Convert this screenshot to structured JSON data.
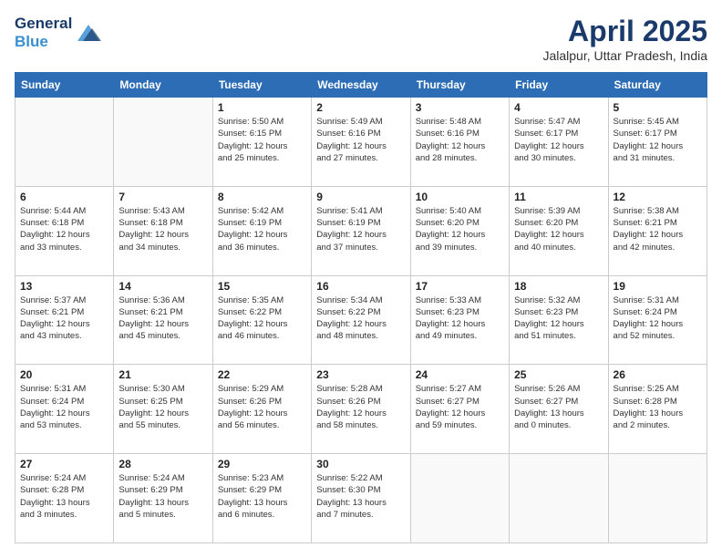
{
  "logo": {
    "line1": "General",
    "line2": "Blue"
  },
  "title": "April 2025",
  "location": "Jalalpur, Uttar Pradesh, India",
  "days_header": [
    "Sunday",
    "Monday",
    "Tuesday",
    "Wednesday",
    "Thursday",
    "Friday",
    "Saturday"
  ],
  "weeks": [
    [
      {
        "day": "",
        "info": ""
      },
      {
        "day": "",
        "info": ""
      },
      {
        "day": "1",
        "info": "Sunrise: 5:50 AM\nSunset: 6:15 PM\nDaylight: 12 hours\nand 25 minutes."
      },
      {
        "day": "2",
        "info": "Sunrise: 5:49 AM\nSunset: 6:16 PM\nDaylight: 12 hours\nand 27 minutes."
      },
      {
        "day": "3",
        "info": "Sunrise: 5:48 AM\nSunset: 6:16 PM\nDaylight: 12 hours\nand 28 minutes."
      },
      {
        "day": "4",
        "info": "Sunrise: 5:47 AM\nSunset: 6:17 PM\nDaylight: 12 hours\nand 30 minutes."
      },
      {
        "day": "5",
        "info": "Sunrise: 5:45 AM\nSunset: 6:17 PM\nDaylight: 12 hours\nand 31 minutes."
      }
    ],
    [
      {
        "day": "6",
        "info": "Sunrise: 5:44 AM\nSunset: 6:18 PM\nDaylight: 12 hours\nand 33 minutes."
      },
      {
        "day": "7",
        "info": "Sunrise: 5:43 AM\nSunset: 6:18 PM\nDaylight: 12 hours\nand 34 minutes."
      },
      {
        "day": "8",
        "info": "Sunrise: 5:42 AM\nSunset: 6:19 PM\nDaylight: 12 hours\nand 36 minutes."
      },
      {
        "day": "9",
        "info": "Sunrise: 5:41 AM\nSunset: 6:19 PM\nDaylight: 12 hours\nand 37 minutes."
      },
      {
        "day": "10",
        "info": "Sunrise: 5:40 AM\nSunset: 6:20 PM\nDaylight: 12 hours\nand 39 minutes."
      },
      {
        "day": "11",
        "info": "Sunrise: 5:39 AM\nSunset: 6:20 PM\nDaylight: 12 hours\nand 40 minutes."
      },
      {
        "day": "12",
        "info": "Sunrise: 5:38 AM\nSunset: 6:21 PM\nDaylight: 12 hours\nand 42 minutes."
      }
    ],
    [
      {
        "day": "13",
        "info": "Sunrise: 5:37 AM\nSunset: 6:21 PM\nDaylight: 12 hours\nand 43 minutes."
      },
      {
        "day": "14",
        "info": "Sunrise: 5:36 AM\nSunset: 6:21 PM\nDaylight: 12 hours\nand 45 minutes."
      },
      {
        "day": "15",
        "info": "Sunrise: 5:35 AM\nSunset: 6:22 PM\nDaylight: 12 hours\nand 46 minutes."
      },
      {
        "day": "16",
        "info": "Sunrise: 5:34 AM\nSunset: 6:22 PM\nDaylight: 12 hours\nand 48 minutes."
      },
      {
        "day": "17",
        "info": "Sunrise: 5:33 AM\nSunset: 6:23 PM\nDaylight: 12 hours\nand 49 minutes."
      },
      {
        "day": "18",
        "info": "Sunrise: 5:32 AM\nSunset: 6:23 PM\nDaylight: 12 hours\nand 51 minutes."
      },
      {
        "day": "19",
        "info": "Sunrise: 5:31 AM\nSunset: 6:24 PM\nDaylight: 12 hours\nand 52 minutes."
      }
    ],
    [
      {
        "day": "20",
        "info": "Sunrise: 5:31 AM\nSunset: 6:24 PM\nDaylight: 12 hours\nand 53 minutes."
      },
      {
        "day": "21",
        "info": "Sunrise: 5:30 AM\nSunset: 6:25 PM\nDaylight: 12 hours\nand 55 minutes."
      },
      {
        "day": "22",
        "info": "Sunrise: 5:29 AM\nSunset: 6:26 PM\nDaylight: 12 hours\nand 56 minutes."
      },
      {
        "day": "23",
        "info": "Sunrise: 5:28 AM\nSunset: 6:26 PM\nDaylight: 12 hours\nand 58 minutes."
      },
      {
        "day": "24",
        "info": "Sunrise: 5:27 AM\nSunset: 6:27 PM\nDaylight: 12 hours\nand 59 minutes."
      },
      {
        "day": "25",
        "info": "Sunrise: 5:26 AM\nSunset: 6:27 PM\nDaylight: 13 hours\nand 0 minutes."
      },
      {
        "day": "26",
        "info": "Sunrise: 5:25 AM\nSunset: 6:28 PM\nDaylight: 13 hours\nand 2 minutes."
      }
    ],
    [
      {
        "day": "27",
        "info": "Sunrise: 5:24 AM\nSunset: 6:28 PM\nDaylight: 13 hours\nand 3 minutes."
      },
      {
        "day": "28",
        "info": "Sunrise: 5:24 AM\nSunset: 6:29 PM\nDaylight: 13 hours\nand 5 minutes."
      },
      {
        "day": "29",
        "info": "Sunrise: 5:23 AM\nSunset: 6:29 PM\nDaylight: 13 hours\nand 6 minutes."
      },
      {
        "day": "30",
        "info": "Sunrise: 5:22 AM\nSunset: 6:30 PM\nDaylight: 13 hours\nand 7 minutes."
      },
      {
        "day": "",
        "info": ""
      },
      {
        "day": "",
        "info": ""
      },
      {
        "day": "",
        "info": ""
      }
    ]
  ]
}
